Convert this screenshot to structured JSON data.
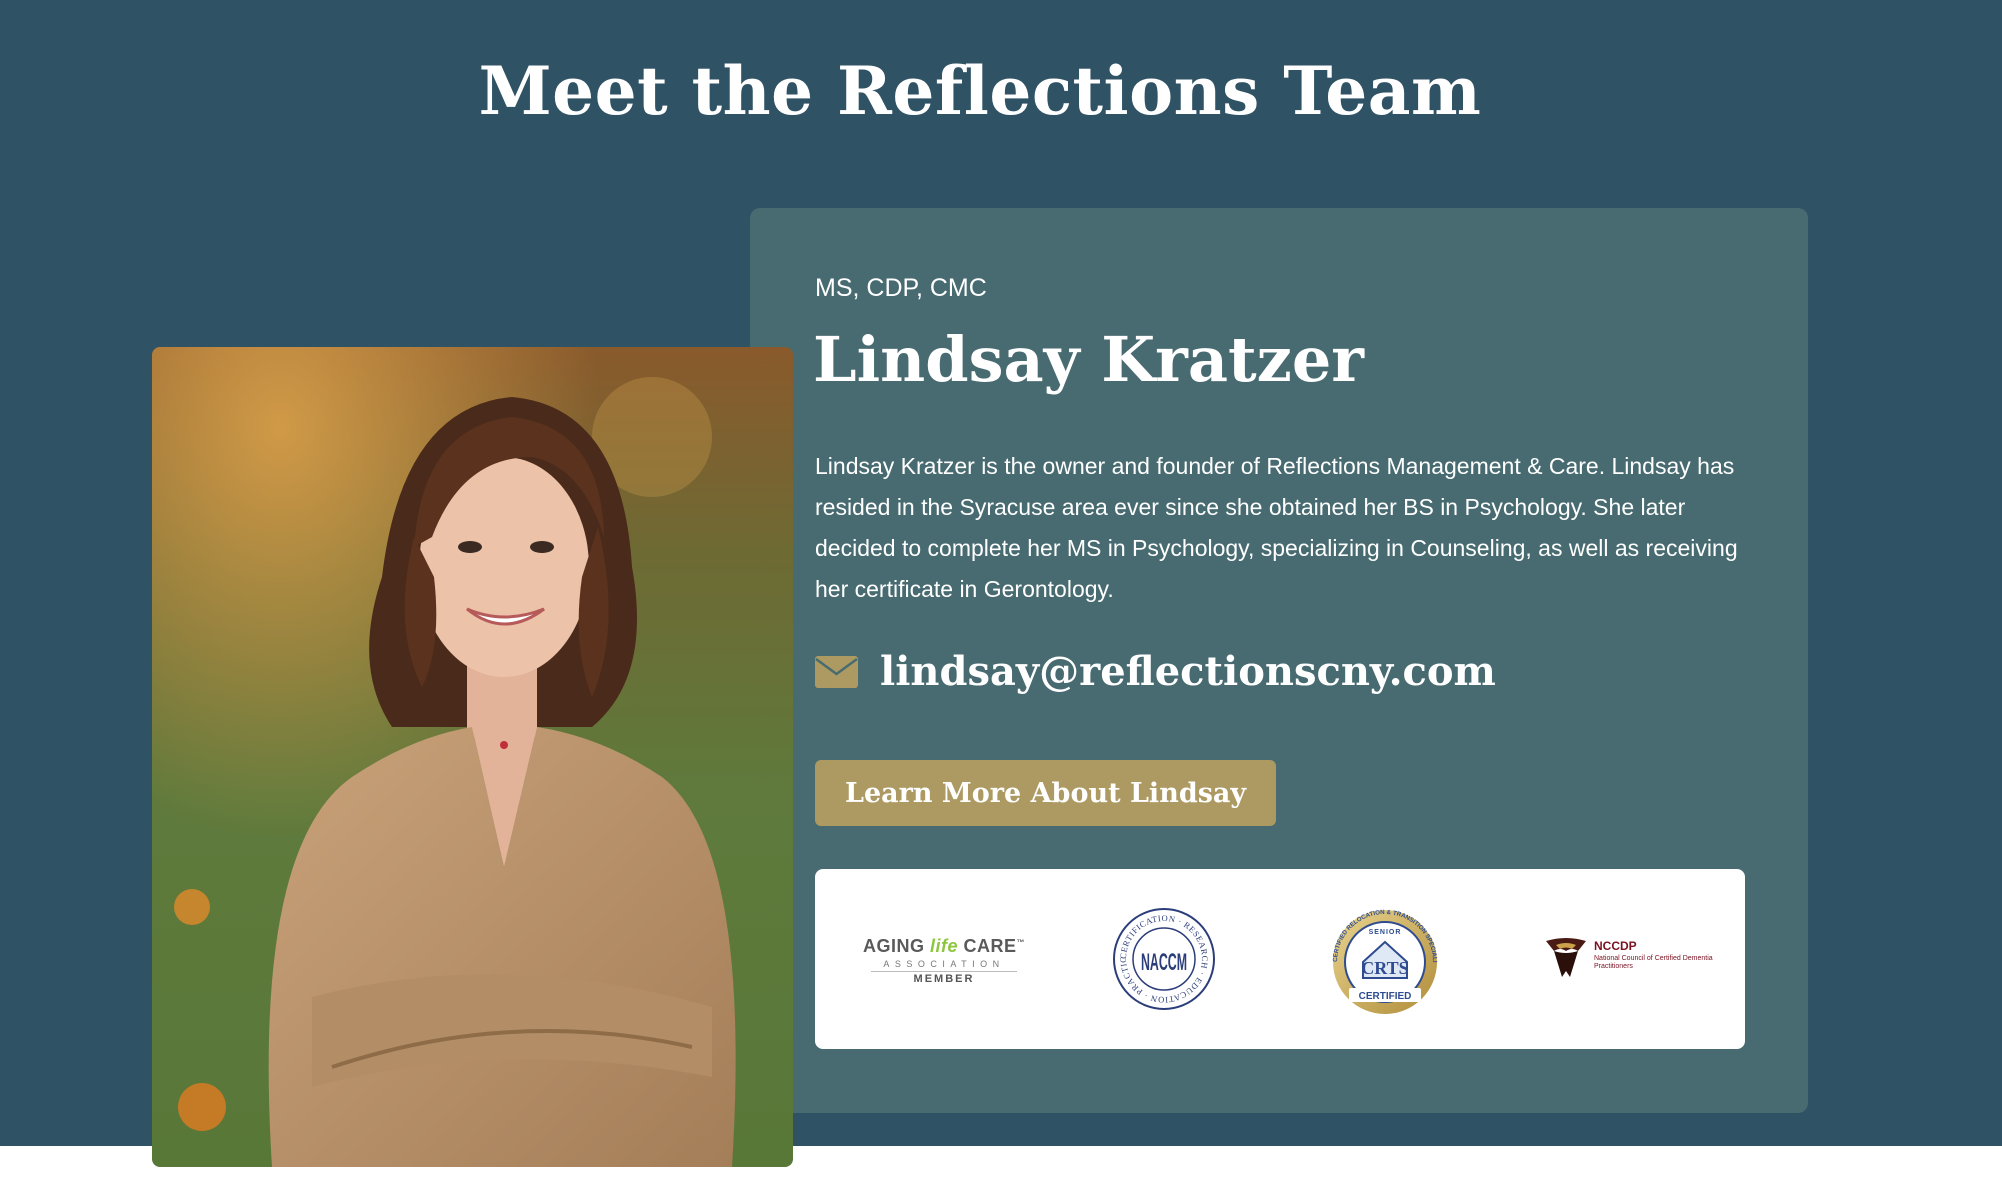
{
  "section": {
    "heading": "Meet the Reflections Team"
  },
  "member": {
    "credentials": "MS, CDP, CMC",
    "name": "Lindsay Kratzer",
    "bio": "Lindsay Kratzer is the owner and founder of Reflections Management & Care. Lindsay has resided in the Syracuse area ever since she obtained her BS in Psychology. She later decided to complete her MS in Psychology, specializing in Counseling, as well as receiving her certificate in Gerontology.",
    "email": "lindsay@reflectionscny.com",
    "email_icon": "envelope-icon",
    "cta_label": "Learn More About Lindsay",
    "photo_icon": "portrait-photo"
  },
  "logos": {
    "alca": {
      "line1_a": "AGING ",
      "line1_b": "life",
      "line1_c": " CARE",
      "tm": "™",
      "line2": "ASSOCIATION",
      "line3": "MEMBER"
    },
    "naccm": {
      "center": "NACCM",
      "ring": "CERTIFICATION · RESEARCH · EDUCATION · PRACTICE ·"
    },
    "crts": {
      "ring": "CERTIFIED RELOCATION & TRANSITION SPECIALIST",
      "top": "SENIOR",
      "center": "CRTS",
      "bottom": "CERTIFIED"
    },
    "nccdp": {
      "title": "NCCDP",
      "subtitle": "National Council of Certified Dementia Practitioners"
    }
  },
  "colors": {
    "band": "#2f5264",
    "card": "#476b70",
    "accent_gold": "#ad9a62",
    "text": "#ffffff"
  }
}
